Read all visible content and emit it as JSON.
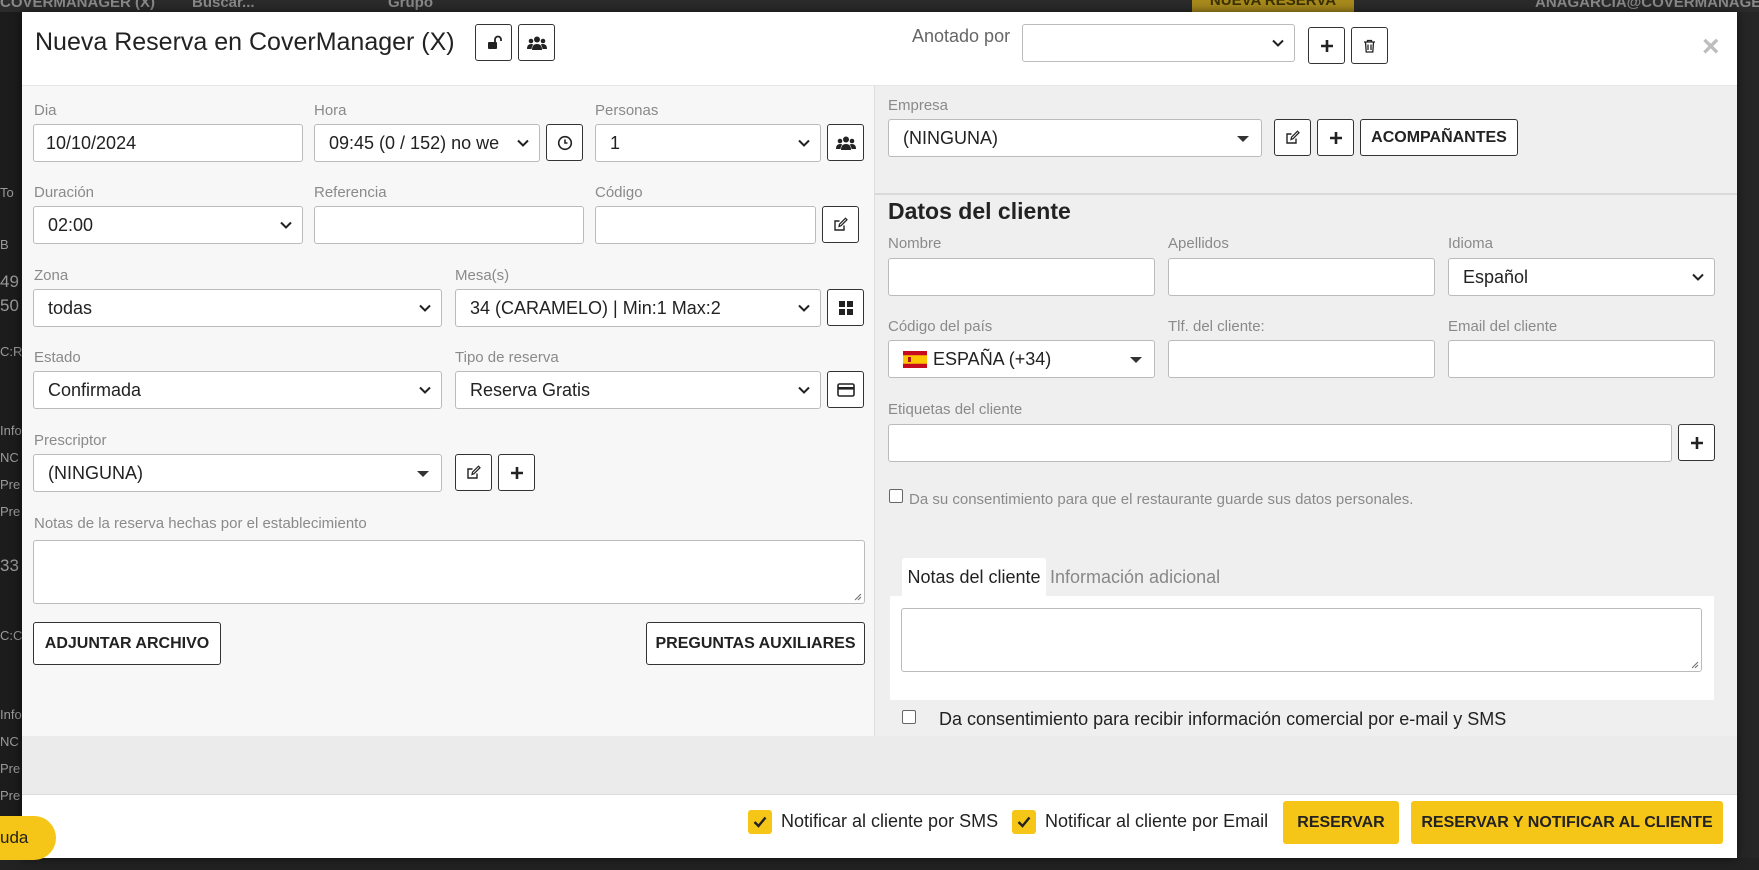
{
  "background": {
    "top_texts": [
      "COVERMANAGER (X)",
      "Buscar...",
      "Grupo",
      "ANAGARCIA@COVERMANAGER"
    ],
    "nueva_reserva": "NUEVA RESERVA",
    "side_texts": [
      "To",
      "B",
      "49",
      "50",
      "C:R",
      "Info",
      "NC",
      "Pre",
      "Pre",
      "33",
      "C:C",
      "Info",
      "NC",
      "Pre",
      "Pre"
    ],
    "help_label": "uda"
  },
  "header": {
    "title": "Nueva Reserva en CoverManager (X)",
    "anotado_label": "Anotado por",
    "anotado_value": "",
    "close": "×"
  },
  "left": {
    "dia_label": "Dia",
    "dia_value": "10/10/2024",
    "hora_label": "Hora",
    "hora_value": "09:45   (0 / 152) no we",
    "personas_label": "Personas",
    "personas_value": "1",
    "duracion_label": "Duración",
    "duracion_value": "02:00",
    "referencia_label": "Referencia",
    "referencia_value": "",
    "codigo_label": "Código",
    "codigo_value": "",
    "zona_label": "Zona",
    "zona_value": "todas",
    "mesa_label": "Mesa(s)",
    "mesa_value": "34 (CARAMELO) | Min:1 Max:2",
    "estado_label": "Estado",
    "estado_value": "Confirmada",
    "tipo_label": "Tipo de reserva",
    "tipo_value": "Reserva Gratis",
    "prescriptor_label": "Prescriptor",
    "prescriptor_value": "(NINGUNA)",
    "notas_label": "Notas de la reserva hechas por el establecimiento",
    "adjuntar_label": "ADJUNTAR ARCHIVO",
    "preguntas_label": "PREGUNTAS AUXILIARES"
  },
  "right": {
    "empresa_label": "Empresa",
    "empresa_value": "(NINGUNA)",
    "acompanantes_label": "ACOMPAÑANTES",
    "section_title": "Datos del cliente",
    "nombre_label": "Nombre",
    "nombre_value": "",
    "apellidos_label": "Apellidos",
    "apellidos_value": "",
    "idioma_label": "Idioma",
    "idioma_value": "Español",
    "codigo_pais_label": "Código del país",
    "codigo_pais_value": "ESPAÑA (+34)",
    "tlf_label": "Tlf. del cliente:",
    "tlf_value": "",
    "email_label": "Email del cliente",
    "email_value": "",
    "etiquetas_label": "Etiquetas del cliente",
    "consent_data_label": "Da su consentimiento para que el restaurante guarde sus datos personales.",
    "tab_notas": "Notas del cliente",
    "tab_info": "Información adicional",
    "consent_comercial_label": "Da consentimiento para recibir información comercial por e-mail y SMS"
  },
  "footer": {
    "sms_label": "Notificar al cliente por SMS",
    "email_label": "Notificar al cliente por Email",
    "reservar_label": "RESERVAR",
    "reservar_notificar_label": "RESERVAR Y NOTIFICAR AL CLIENTE",
    "sms_checked": true,
    "email_checked": true
  },
  "colors": {
    "accent": "#f5c518",
    "text": "#222222",
    "label": "#8a8a8a"
  },
  "icons": [
    "lock-open-icon",
    "users-icon",
    "chevron-down-icon",
    "plus-icon",
    "trash-icon",
    "clock-icon",
    "edit-icon",
    "grid-icon",
    "credit-card-icon",
    "check-icon",
    "spain-flag-icon",
    "close-icon"
  ]
}
